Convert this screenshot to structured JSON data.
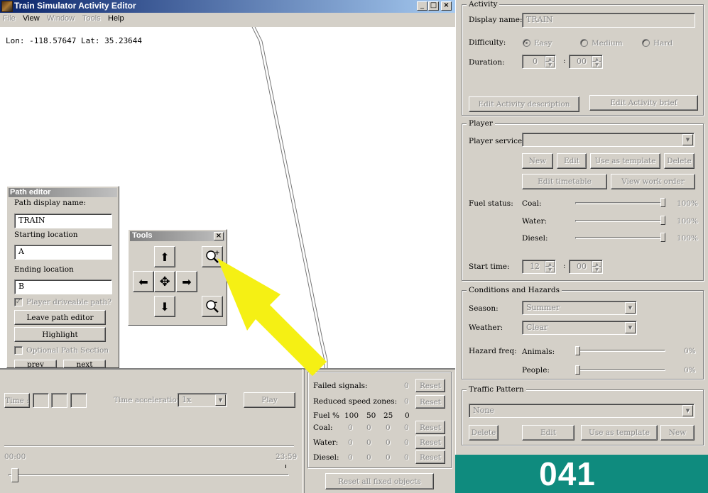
{
  "window": {
    "title": "Train Simulator Activity Editor",
    "menu": [
      "File",
      "View",
      "Window",
      "Tools",
      "Help"
    ],
    "coords": "Lon: -118.57647 Lat: 35.23644"
  },
  "path_editor": {
    "title": "Path editor",
    "display_name_label": "Path display name:",
    "display_name": "TRAIN",
    "start_label": "Starting location",
    "start": "A",
    "end_label": "Ending location",
    "end": "B",
    "driveable_label": "Player driveable path?",
    "leave_label": "Leave path editor",
    "highlight_label": "Highlight",
    "optional_label": "Optional Path Section",
    "prev_label": "prev",
    "next_label": "next"
  },
  "tools": {
    "title": "Tools",
    "close": "×"
  },
  "timebar": {
    "time_label": "Time :",
    "accel_label": "Time acceleration",
    "accel_value": "1x",
    "play_label": "Play",
    "start_time": "00:00",
    "end_time": "23:59"
  },
  "stats": {
    "failed_signals_label": "Failed signals:",
    "failed_signals": "0",
    "reduced_label": "Reduced speed zones:",
    "reduced": "0",
    "fuel_label": "Fuel %",
    "fuel_cols": [
      "100",
      "50",
      "25",
      "0"
    ],
    "rows": [
      {
        "label": "Coal:",
        "values": [
          "0",
          "0",
          "0",
          "0"
        ]
      },
      {
        "label": "Water:",
        "values": [
          "0",
          "0",
          "0",
          "0"
        ]
      },
      {
        "label": "Diesel:",
        "values": [
          "0",
          "0",
          "0",
          "0"
        ]
      }
    ],
    "reset_label": "Reset",
    "reset_all_label": "Reset all fixed objects"
  },
  "activity": {
    "title": "Activity",
    "display_name_label": "Display name:",
    "display_name": "TRAIN",
    "difficulty_label": "Difficulty:",
    "easy": "Easy",
    "medium": "Medium",
    "hard": "Hard",
    "duration_label": "Duration:",
    "duration_h": "0",
    "duration_m": "00",
    "edit_desc_label": "Edit Activity description",
    "edit_brief_label": "Edit Activity brief"
  },
  "player": {
    "title": "Player",
    "service_label": "Player service:",
    "new_label": "New",
    "edit_label": "Edit",
    "template_label": "Use as template",
    "delete_label": "Delete",
    "timetable_label": "Edit timetable",
    "work_order_label": "View work order",
    "fuel_label": "Fuel status:",
    "coal_label": "Coal:",
    "coal": "100%",
    "water_label": "Water:",
    "water": "100%",
    "diesel_label": "Diesel:",
    "diesel": "100%",
    "fuel_levels": [
      1.0,
      1.0,
      1.0
    ],
    "start_time_label": "Start time:",
    "start_h": "12",
    "start_m": "00"
  },
  "conditions": {
    "title": "Conditions and Hazards",
    "season_label": "Season:",
    "season": "Summer",
    "weather_label": "Weather:",
    "weather": "Clear",
    "hazard_label": "Hazard freq:",
    "animals_label": "Animals:",
    "animals": "0%",
    "people_label": "People:",
    "people": "0%",
    "hazard_levels": [
      0,
      0
    ]
  },
  "traffic": {
    "title": "Traffic Pattern",
    "value": "None",
    "delete_label": "Delete",
    "edit_label": "Edit",
    "template_label": "Use as template",
    "new_label": "New"
  },
  "overlay_number": "041",
  "colors": {
    "titlebar_start": "#0a246a",
    "titlebar_end": "#a6caf0",
    "teal": "#0f8b7e",
    "arrow": "#f5f014"
  }
}
